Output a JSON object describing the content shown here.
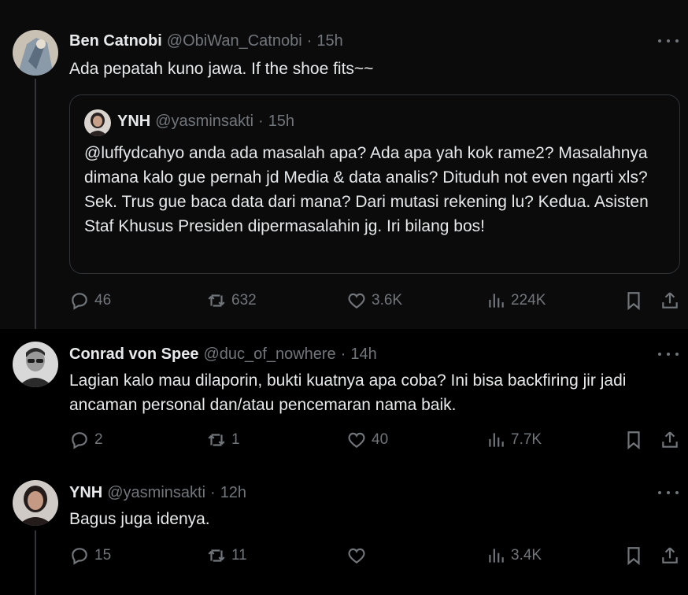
{
  "tweets": [
    {
      "name": "Ben Catnobi",
      "handle": "@ObiWan_Catnobi",
      "time": "15h",
      "text": "Ada pepatah kuno jawa. If the shoe fits~~",
      "quote": {
        "name": "YNH",
        "handle": "@yasminsakti",
        "time": "15h",
        "text": "@luffydcahyo anda ada masalah apa? Ada apa yah kok rame2? Masalahnya dimana kalo gue pernah jd Media & data analis? Dituduh not even ngarti xls? Sek. Trus gue baca data dari mana? Dari mutasi rekening lu? Kedua. Asisten Staf Khusus Presiden dipermasalahin jg. Iri bilang bos!"
      },
      "replies": "46",
      "reposts": "632",
      "likes": "3.6K",
      "views": "224K"
    },
    {
      "name": "Conrad von Spee",
      "handle": "@duc_of_nowhere",
      "time": "14h",
      "text": "Lagian kalo mau dilaporin, bukti kuatnya apa coba? Ini bisa backfiring jir jadi ancaman personal dan/atau pencemaran nama baik.",
      "replies": "2",
      "reposts": "1",
      "likes": "40",
      "views": "7.7K"
    },
    {
      "name": "YNH",
      "handle": "@yasminsakti",
      "time": "12h",
      "text": "Bagus juga idenya.",
      "replies": "15",
      "reposts": "11",
      "likes": "",
      "views": "3.4K"
    }
  ],
  "separator": "·",
  "icons": {
    "reply": "reply-icon",
    "repost": "repost-icon",
    "like": "heart-icon",
    "views": "views-icon",
    "bookmark": "bookmark-icon",
    "share": "share-icon",
    "more": "more-icon"
  },
  "colors": {
    "background": "#000000",
    "text": "#e7e9ea",
    "muted": "#71767b",
    "border": "#2f3336"
  }
}
